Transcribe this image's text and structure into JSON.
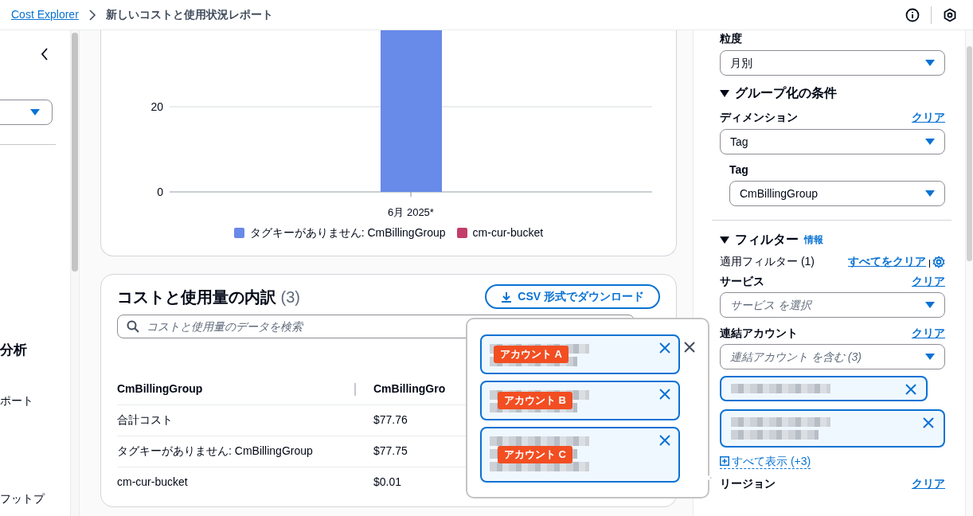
{
  "breadcrumb": [
    {
      "label": "Cost Explorer",
      "kind": "link"
    },
    {
      "label": "新しいコストと使用状況レポート",
      "kind": "current"
    }
  ],
  "sidebar": {
    "items": [
      {
        "label": "分析",
        "kind": "heading"
      },
      {
        "label": "ポート",
        "kind": "item"
      },
      {
        "label": "フットプ",
        "kind": "item"
      }
    ]
  },
  "chart": {
    "yticks": [
      "20",
      "0"
    ],
    "category": "6月 2025*",
    "legend": [
      {
        "name": "タグキーがありません: CmBillingGroup",
        "color": "#688ae8"
      },
      {
        "name": "cm-cur-bucket",
        "color": "#c33d69"
      }
    ]
  },
  "breakdown": {
    "title": "コストと使用量の内訳",
    "count": "(3)",
    "download": "CSV 形式でダウンロード",
    "search": {
      "placeholder": "コストと使用量のデータを検索"
    },
    "columns": [
      "CmBillingGroup",
      "CmBillingGro"
    ],
    "rows": [
      [
        "合計コスト",
        "$77.76"
      ],
      [
        "タグキーがありません: CmBillingGroup",
        "$77.75"
      ],
      [
        "cm-cur-bucket",
        "$0.01"
      ]
    ]
  },
  "popover": {
    "tokens": [
      {
        "tag": "アカウント A",
        "kind": "short"
      },
      {
        "tag": "アカウント B",
        "kind": "short"
      },
      {
        "tag": "アカウント C",
        "kind": "tall"
      }
    ]
  },
  "panel": {
    "granularity": {
      "label": "粒度",
      "value": "月別"
    },
    "group": {
      "title": "グループ化の条件",
      "expanded": true,
      "dimension": {
        "label": "ディメンション",
        "clear": "クリア",
        "value": "Tag"
      },
      "tag": {
        "label": "Tag",
        "value": "CmBillingGroup"
      }
    },
    "filters": {
      "title": "フィルター",
      "expanded": true,
      "info": "情報",
      "applied": "適用フィルター (1)",
      "clear_all": "すべてをクリア",
      "service": {
        "label": "サービス",
        "clear": "クリア",
        "placeholder": "サービス を選択"
      },
      "account": {
        "label": "連結アカウント",
        "clear": "クリア",
        "placeholder": "連結アカウント を含む (3)",
        "tokens": [
          {
            "kind": "short"
          },
          {
            "kind": "tall"
          }
        ],
        "show_all": "すべて表示 (+3)"
      },
      "region": {
        "label": "リージョン",
        "clear": "クリア"
      }
    }
  }
}
